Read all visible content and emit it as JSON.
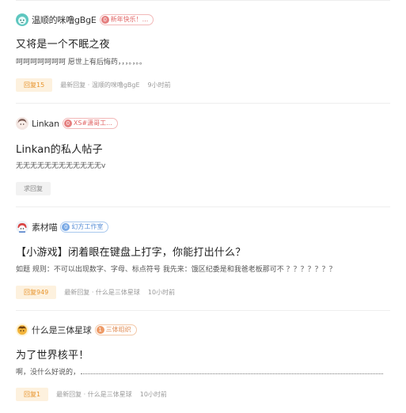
{
  "posts": [
    {
      "author": "温顺的咪噜gBgE",
      "badge": {
        "level": "0",
        "text": "新年快乐！...",
        "tone": "red"
      },
      "title": "又将是一个不眠之夜",
      "excerpt": "呵呵呵呵呵呵呵 愿世上有后悔药，，，。，。。",
      "reply": "回复15",
      "last_reply": "最新回复 · 温顺的咪噜gBgE",
      "time": "9小时前"
    },
    {
      "author": "Linkan",
      "badge": {
        "level": "0",
        "text": "XS#潇哥工...",
        "tone": "red"
      },
      "title": "Linkan的私人帖子",
      "excerpt": "无无无无无无无无无无无无v",
      "reply": "求回复",
      "last_reply": "",
      "time": ""
    },
    {
      "author": "素材喵",
      "badge": {
        "level": "0",
        "text": "幻方工作室",
        "tone": "blue"
      },
      "title": "【小游戏】闭着眼在键盘上打字，你能打出什么？",
      "excerpt": "如题 规则：不可以出现数字、字母、标点符号 我先来：饿区纪委是和我爸老板那可不 ？？？？？？？",
      "reply": "回复949",
      "last_reply": "最新回复 · 什么是三体星球",
      "time": "10小时前"
    },
    {
      "author": "什么是三体星球",
      "badge": {
        "level": "1",
        "text": "三体组织",
        "tone": "orange"
      },
      "title": "为了世界核平！",
      "excerpt": "啊，没什么好说的，",
      "reply": "回复1",
      "last_reply": "最新回复 · 什么是三体星球",
      "time": "10小时前"
    }
  ]
}
